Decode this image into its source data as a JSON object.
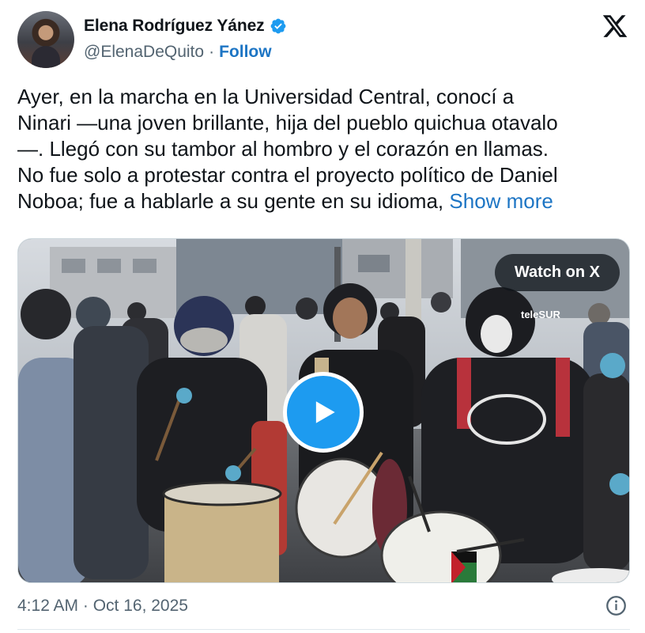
{
  "author": {
    "name": "Elena Rodríguez Yánez",
    "handle": "@ElenaDeQuito",
    "separator": "·",
    "follow_label": "Follow",
    "verified": true,
    "verified_color": "#1d9bf0"
  },
  "brand_icon": "x-logo-icon",
  "tweet": {
    "lines": [
      "Ayer, en la marcha en la Universidad Central, conocí a",
      "Ninari —una joven brillante, hija del pueblo quichua otavalo",
      "—. Llegó con su tambor al hombro y el corazón en llamas.",
      "No fue solo a protestar contra el proyecto político de Daniel",
      "Noboa; fue a hablarle a su gente en su idioma,"
    ],
    "show_more_label": "Show more",
    "link_color": "#1d75c4"
  },
  "media": {
    "watch_label": "Watch on X",
    "play_icon": "play-icon",
    "watermark": "teleSUR",
    "play_color": "#1d9bf0"
  },
  "footer": {
    "timestamp": "4:12 AM · Oct 16, 2025",
    "info_icon": "info-icon"
  }
}
